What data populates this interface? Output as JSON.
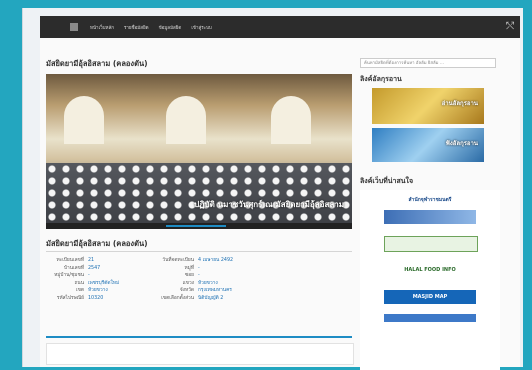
{
  "nav": {
    "items": [
      "หน้าเว็บหลัก",
      "รายชื่อมัสยิด",
      "ข้อมูลมัสยิด",
      "เข้าสู่ระบบ"
    ]
  },
  "main": {
    "title": "มัสยิดยามีอุ้ลอิสลาม (คลองตัน)",
    "photo_caption": "ปฏิบัติ นมาซวันศุกร์ ณ มัสยิดยามีอุ้ลอิสลาม",
    "info_title": "มัสยิดยามีอุ้ลอิสลาม (คลองตัน)",
    "info_rows": [
      {
        "l1": "ทะเบียนเลขที่",
        "v1": "21",
        "l2": "วันที่จดทะเบียน",
        "v2": "4 เมษายน 2492"
      },
      {
        "l1": "บ้านเลขที่",
        "v1": "2547",
        "l2": "หมู่ที่",
        "v2": "-"
      },
      {
        "l1": "หมู่บ้าน/ชุมชน",
        "v1": "-",
        "l2": "ซอย",
        "v2": "-"
      },
      {
        "l1": "ถนน",
        "v1": "เพชรบุรีตัดใหม่",
        "l2": "แขวง",
        "v2": "ห้วยขวาง"
      },
      {
        "l1": "เขต",
        "v1": "ห้วยขวาง",
        "l2": "จังหวัด",
        "v2": "กรุงเทพมหานคร"
      },
      {
        "l1": "รหัสไปรษณีย์",
        "v1": "10320",
        "l2": "เขตเลือกตั้งส่วน",
        "v2": "นิติบัญญัติ 2"
      }
    ]
  },
  "sidebar": {
    "search_placeholder": "ค้นหามัสยิดที่ต้องการค้นหา อัลฮัม ยิสลัม ...",
    "quran_title": "ลิงค์อัลกุรอาน",
    "quran_links": [
      "อ่านอัลกุรอาน",
      "ฟังอัลกุรอาน"
    ],
    "links_title": "ลิงค์เว็บที่น่าสนใจ",
    "links": [
      "สำนักจุฬาราชมนตรี",
      "HALAL FOOD INFO",
      "MASJID MAP"
    ]
  },
  "colors": {
    "accent": "#1e8cc4",
    "background": "#23a6bf",
    "topbar": "#2c2c2c"
  }
}
